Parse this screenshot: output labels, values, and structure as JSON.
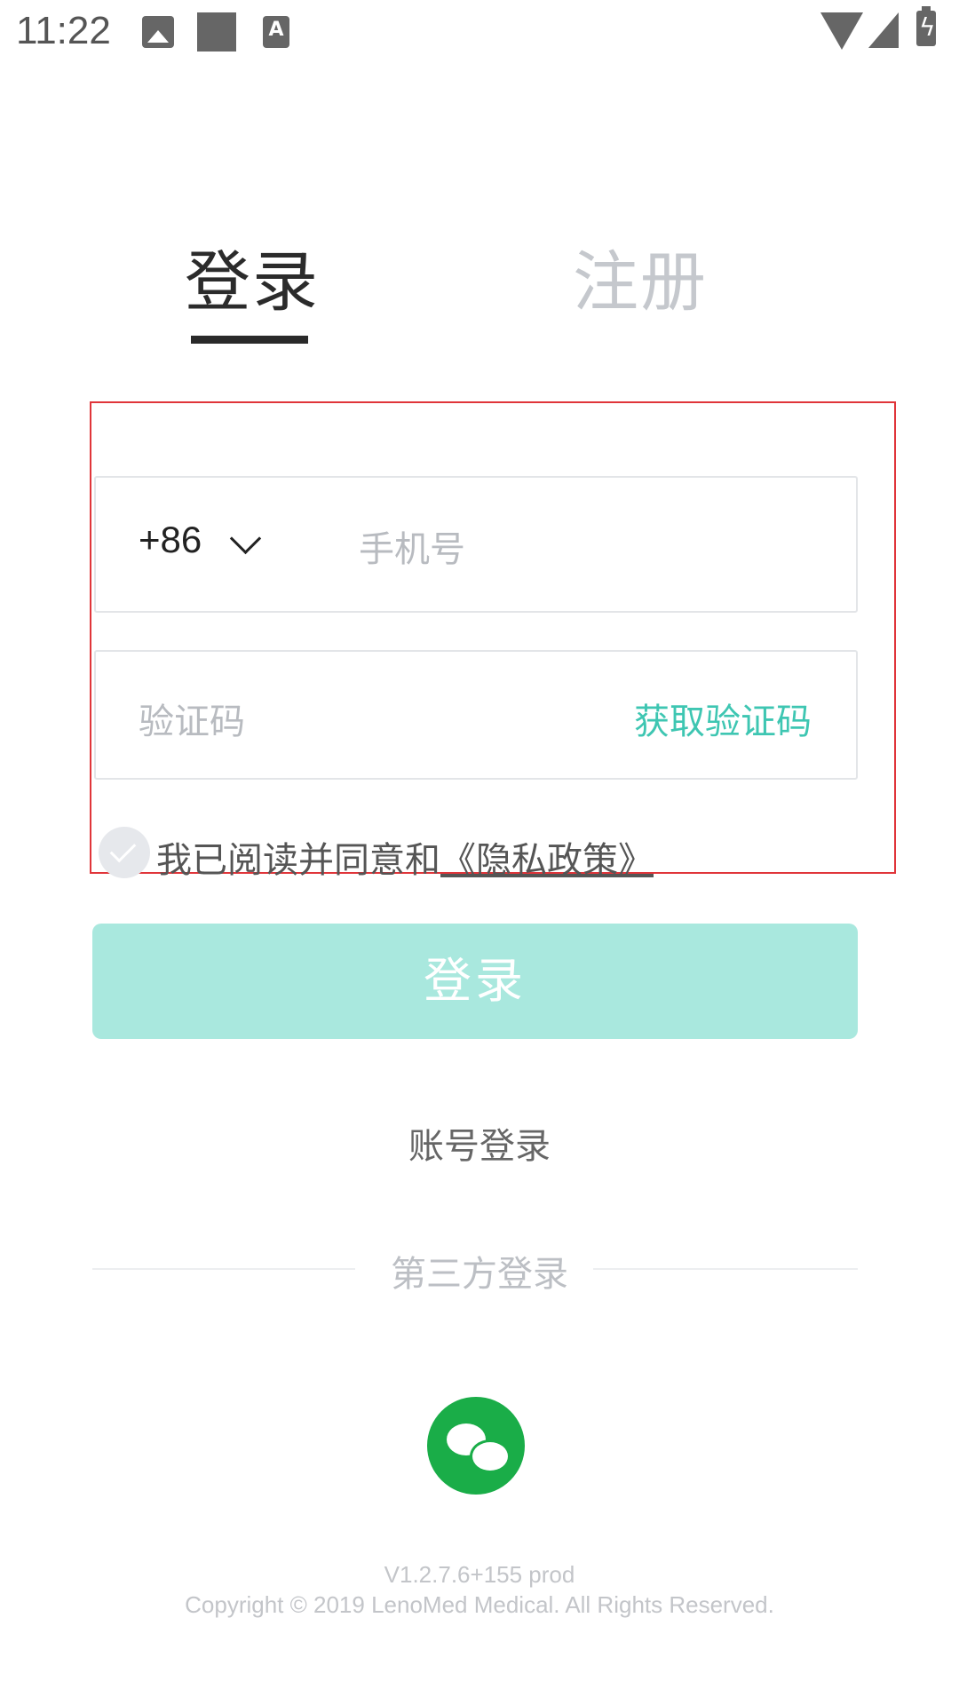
{
  "status_bar": {
    "time": "11:22",
    "a_icon_letter": "A"
  },
  "tabs": {
    "login": "登录",
    "register": "注册"
  },
  "phone": {
    "country_code": "+86",
    "placeholder": "手机号"
  },
  "code": {
    "placeholder": "验证码",
    "get_code": "获取验证码"
  },
  "agreement": {
    "text": "我已阅读并同意和",
    "link": "《隐私政策》"
  },
  "login_button": "登录",
  "account_login": "账号登录",
  "third_party": "第三方登录",
  "footer": {
    "version": "V1.2.7.6+155 prod",
    "copyright": "Copyright © 2019 LenoMed Medical. All Rights Reserved."
  },
  "colors": {
    "accent": "#3ec6b2",
    "button_disabled": "#a9e8de",
    "wechat": "#1aad48",
    "highlight": "#e0353a"
  },
  "icons": [
    "image-icon",
    "square-icon",
    "a-icon",
    "wifi-icon",
    "signal-icon",
    "battery-icon",
    "chevron-down-icon",
    "check-icon",
    "wechat-icon"
  ]
}
